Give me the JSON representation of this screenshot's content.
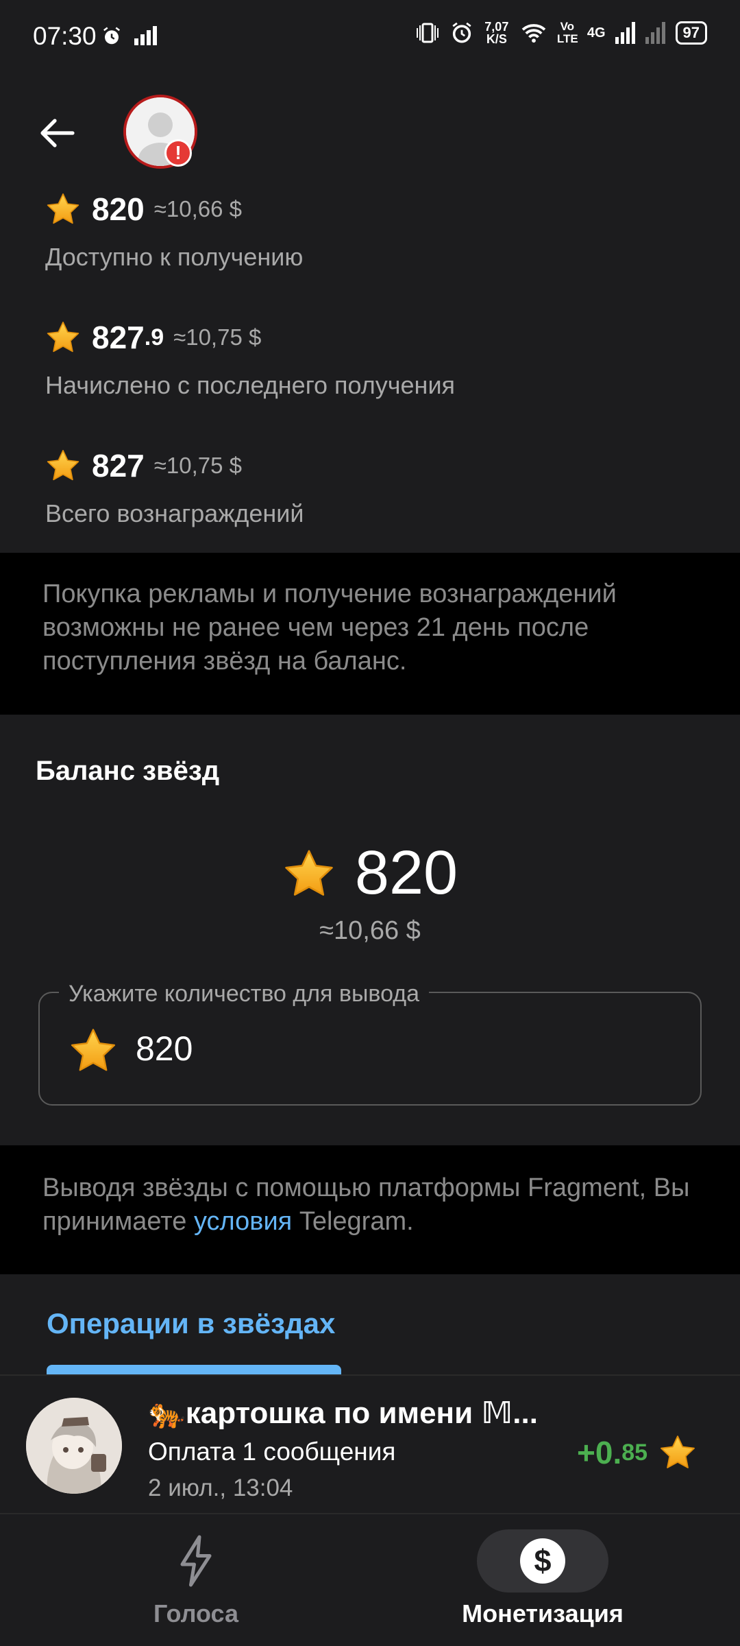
{
  "status_bar": {
    "time": "07:30",
    "network_speed": "7,07 K/S",
    "volte": "Vo LTE",
    "net_type": "4G",
    "battery": "97"
  },
  "header": {
    "back_icon": "arrow-left-icon",
    "avatar_alert": "!"
  },
  "stats": [
    {
      "value": "820",
      "fraction": "",
      "usd": "≈10,66 $",
      "label": "Доступно к получению"
    },
    {
      "value": "827",
      "fraction": ".9",
      "usd": "≈10,75 $",
      "label": "Начислено с последнего получения"
    },
    {
      "value": "827",
      "fraction": "",
      "usd": "≈10,75 $",
      "label": "Всего вознаграждений"
    }
  ],
  "info_notice": "Покупка рекламы и получение вознаграждений возможны не ранее чем через 21 день после поступления звёзд на баланс.",
  "balance": {
    "title": "Баланс звёзд",
    "value": "820",
    "usd": "≈10,66 $",
    "input_label": "Укажите количество для вывода",
    "input_value": "820"
  },
  "withdraw_notice": {
    "before": "Выводя звёзды с помощью платформы Fragment, Вы принимаете ",
    "link": "условия",
    "after": " Telegram."
  },
  "operations": {
    "title": "Операции в звёздах"
  },
  "transaction": {
    "name": "🐅картошка по имени 𝕄...",
    "description": "Оплата 1 сообщения",
    "date": "2 июл., 13:04",
    "amount_int": "+0.",
    "amount_frac": "85"
  },
  "nav": [
    {
      "label": "Голоса",
      "icon": "lightning-icon",
      "active": false
    },
    {
      "label": "Монетизация",
      "icon": "dollar-icon",
      "active": true
    }
  ],
  "colors": {
    "accent": "#64b5f6",
    "positive": "#4caf50",
    "card": "#1c1c1e",
    "star": "#f5b915"
  }
}
